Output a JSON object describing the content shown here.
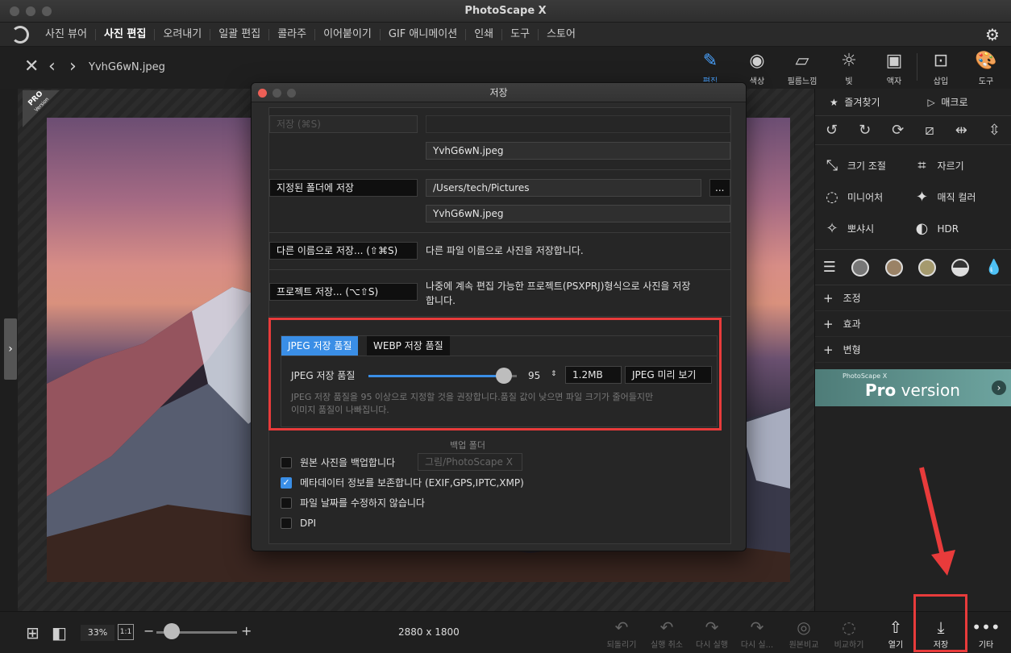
{
  "window": {
    "title": "PhotoScape X"
  },
  "menu": {
    "items": [
      "사진 뷰어",
      "사진 편집",
      "오려내기",
      "일괄 편집",
      "콜라주",
      "이어붙이기",
      "GIF 애니메이션",
      "인쇄",
      "도구",
      "스토어"
    ],
    "active": "사진 편집"
  },
  "editbar": {
    "filename": "YvhG6wN.jpeg",
    "tools": [
      "편집",
      "색상",
      "필름느낌",
      "빛",
      "액자",
      "삽입",
      "도구"
    ]
  },
  "canvas": {
    "pro_badge_line1": "PRO",
    "pro_badge_line2": "Version"
  },
  "right_panel": {
    "favorites": "즐겨찾기",
    "macro": "매크로",
    "grid": [
      "크기 조절",
      "자르기",
      "미니어처",
      "매직 컬러",
      "뽀샤시",
      "HDR"
    ],
    "sections": [
      "조정",
      "효과",
      "변형"
    ],
    "banner_small": "PhotoScape X",
    "banner_pro": "Pro",
    "banner_version": " version"
  },
  "dialog": {
    "title": "저장",
    "save_btn": "저장  (⌘S)",
    "filename": "YvhG6wN.jpeg",
    "save_folder_btn": "지정된 폴더에 저장",
    "folder_path": "/Users/tech/Pictures",
    "browse": "...",
    "filename2": "YvhG6wN.jpeg",
    "save_as_btn": "다른 이름으로 저장...  (⇧⌘S)",
    "save_as_desc": "다른 파일 이름으로 사진을 저장합니다.",
    "project_btn": "프로젝트 저장...  (⌥⇧S)",
    "project_desc_line1": "나중에 계속 편집 가능한 프로젝트(PSXPRJ)형식으로 사진을 저장",
    "project_desc_line2": "합니다.",
    "tab_jpeg": "JPEG 저장 품질",
    "tab_webp": "WEBP 저장 품질",
    "quality_label": "JPEG 저장 품질",
    "quality_value": "95",
    "quality": 95,
    "file_size": "1.2MB",
    "preview_btn": "JPEG 미리 보기",
    "hint_line1": "JPEG 저장 품질을 95 이상으로 지정할 것을 권장합니다.품질 값이 낮으면 파일 크기가 줄어들지만",
    "hint_line2": "이미지 품질이 나빠집니다.",
    "backup_folder_label": "백업 폴더",
    "backup_folder_value": "그림/PhotoScape X",
    "options": [
      {
        "label": "원본 사진을 백업합니다",
        "checked": false
      },
      {
        "label": "메타데이터 정보를 보존합니다 (EXIF,GPS,IPTC,XMP)",
        "checked": true
      },
      {
        "label": "파일 날짜를 수정하지 않습니다",
        "checked": false
      },
      {
        "label": "DPI",
        "checked": false
      }
    ]
  },
  "bottombar": {
    "zoom": "33%",
    "one_to_one": "1:1",
    "dimensions": "2880 x 1800",
    "actions": [
      "되돌리기",
      "실행 취소",
      "다시 실행",
      "다시 실...",
      "원본비교",
      "비교하기",
      "열기",
      "저장",
      "기타"
    ]
  },
  "colors": {
    "accent": "#3a8ee6",
    "highlight": "#e83b3b"
  }
}
